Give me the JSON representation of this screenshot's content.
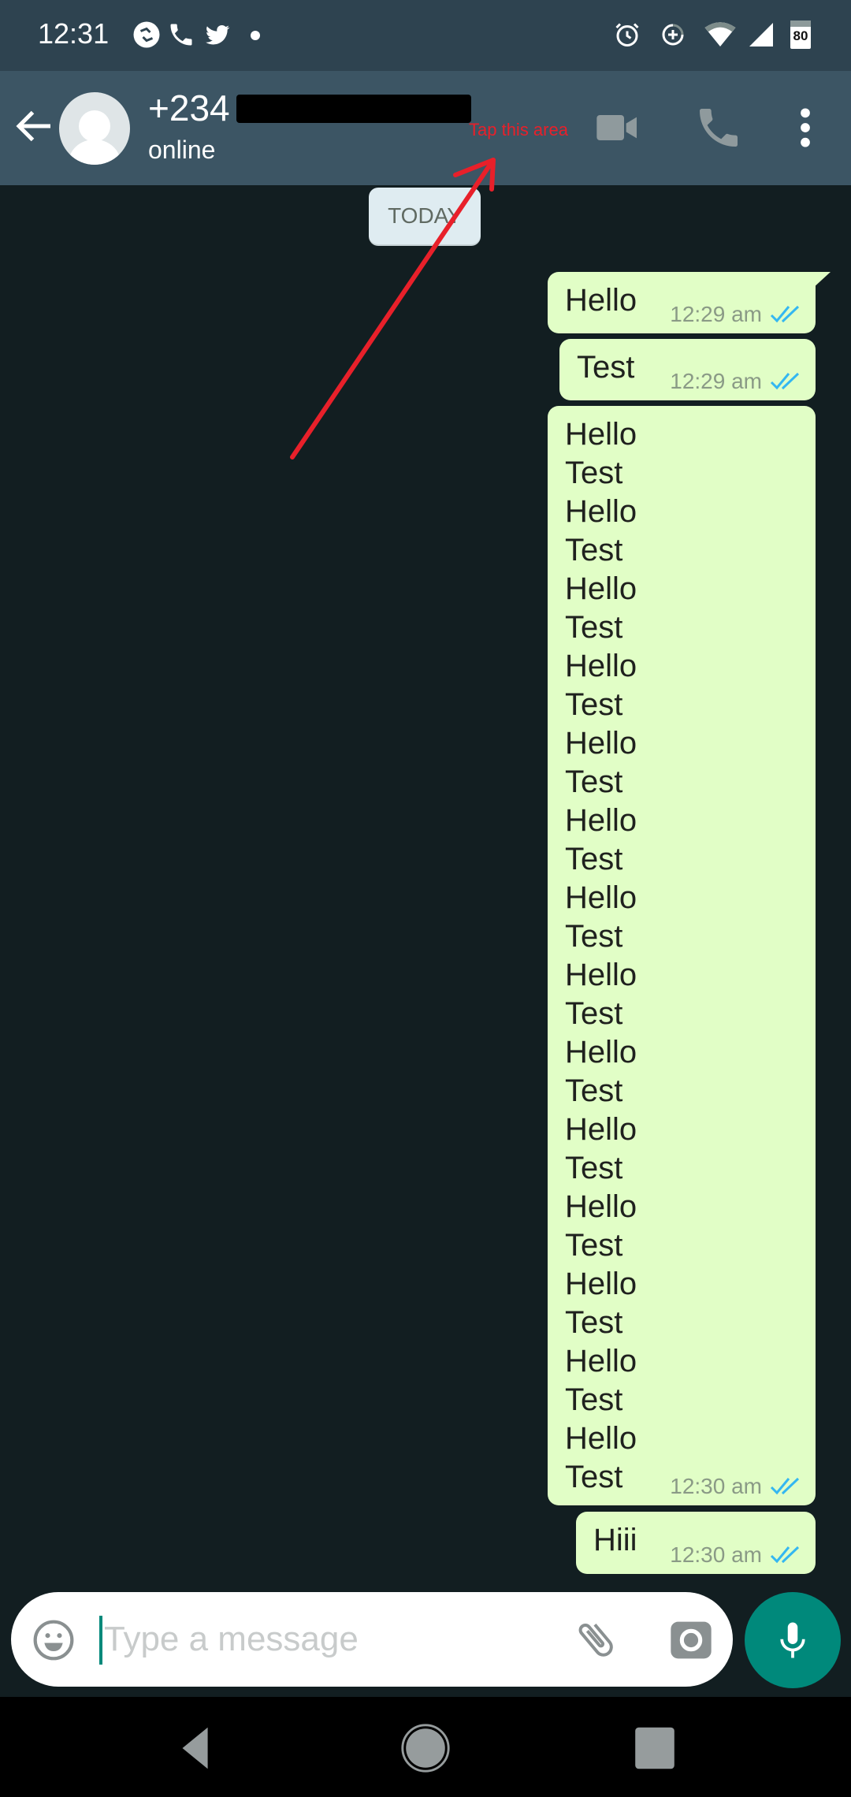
{
  "status_bar": {
    "time": "12:31",
    "left_icons": [
      "app-notification-icon",
      "phone-call-icon",
      "twitter-icon",
      "more-notifications-dot"
    ],
    "right_icons": [
      "alarm-icon",
      "data-saver-icon",
      "wifi-icon",
      "cell-signal-icon",
      "battery-icon"
    ],
    "battery_level": "80"
  },
  "header": {
    "back_icon": "arrow-left-icon",
    "contact_name_visible": "+234",
    "contact_name_redacted": true,
    "status": "online",
    "actions": [
      "video-call-icon",
      "voice-call-icon",
      "more-vert-icon"
    ]
  },
  "annotation": {
    "text": "Tap this area",
    "color": "#e8202a"
  },
  "chat": {
    "date_divider": "TODAY",
    "messages": [
      {
        "text": "Hello",
        "time": "12:29 am",
        "status": "read",
        "direction": "outgoing"
      },
      {
        "text": "Test",
        "time": "12:29 am",
        "status": "read",
        "direction": "outgoing"
      },
      {
        "lines": [
          "Hello",
          "Test",
          "Hello",
          "Test",
          "Hello",
          "Test",
          "Hello",
          "Test",
          "Hello",
          "Test",
          "Hello",
          "Test",
          "Hello",
          "Test",
          "Hello",
          "Test",
          "Hello",
          "Test",
          "Hello",
          "Test",
          "Hello",
          "Test",
          "Hello",
          "Test",
          "Hello",
          "Test",
          "Hello",
          "Test"
        ],
        "time": "12:30 am",
        "status": "read",
        "direction": "outgoing"
      },
      {
        "text": "Hiii",
        "time": "12:30 am",
        "status": "read",
        "direction": "outgoing"
      }
    ]
  },
  "composer": {
    "placeholder": "Type a message",
    "value": "",
    "icons": [
      "emoji-icon",
      "attach-icon",
      "camera-icon",
      "mic-icon"
    ]
  },
  "nav_bar": {
    "buttons": [
      "back",
      "home",
      "recents"
    ]
  },
  "colors": {
    "status_bar": "#2e4350",
    "header": "#3c5564",
    "chat_bg": "#121e21",
    "outgoing_bubble": "#e1fec6",
    "read_tick": "#34b7f1",
    "accent": "#00897b"
  }
}
